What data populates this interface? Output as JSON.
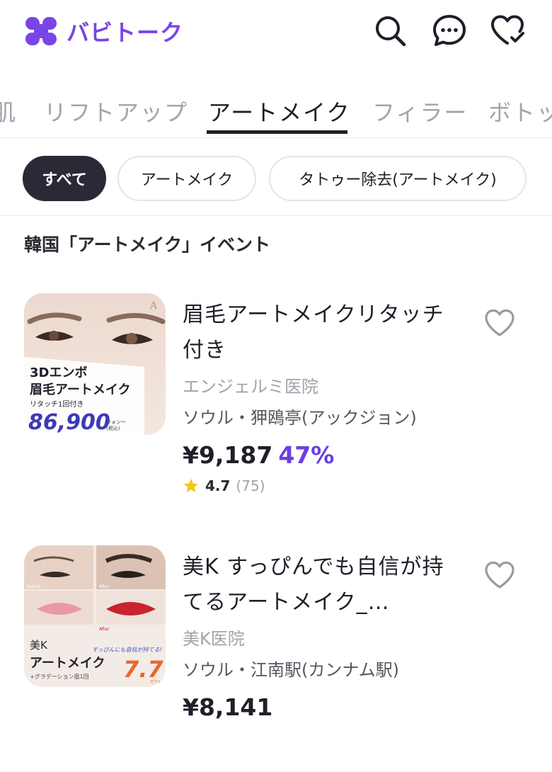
{
  "app": {
    "brand_name": "バビトーク",
    "brand_color": "#7a45e6"
  },
  "header": {
    "icons": [
      "search-icon",
      "chat-icon",
      "heart-check-icon"
    ]
  },
  "category_tabs": {
    "items": [
      {
        "label": "肌",
        "active": false
      },
      {
        "label": "リフトアップ",
        "active": false
      },
      {
        "label": "アートメイク",
        "active": true
      },
      {
        "label": "フィラー",
        "active": false
      },
      {
        "label": "ボトッ",
        "active": false
      }
    ]
  },
  "filter_chips": {
    "items": [
      {
        "label": "すべて",
        "active": true
      },
      {
        "label": "アートメイク",
        "active": false
      },
      {
        "label": "タトゥー除去(アートメイク)",
        "active": false
      }
    ]
  },
  "section": {
    "title": "韓国「アートメイク」イベント"
  },
  "events": [
    {
      "title": "眉毛アートメイクリタッチ付き",
      "clinic": "エンジェルミ医院",
      "location": "ソウル・狎鴎亭(アックジョン)",
      "price": "¥9,187",
      "discount": "47%",
      "rating": "4.7",
      "reviews": "(75)",
      "thumb": {
        "line1": "3Dエンボ",
        "line2": "眉毛アートメイク",
        "line3": "リタッチ1回付き",
        "price": "86,900",
        "unit": "ウォン〜",
        "tax": "(税込)"
      }
    },
    {
      "title": "美K すっぴんでも自信が持てるアートメイク_…",
      "clinic": "美K医院",
      "location": "ソウル・江南駅(カンナム駅)",
      "price": "¥8,141",
      "discount": "",
      "thumb": {
        "before": "Before",
        "after": "After",
        "brand": "美K",
        "title": "アートメイク",
        "sub": "+グラデーション眉1回",
        "tagline": "すっぴんにも自信が持てる!",
        "price": "7.7",
        "unit": "万ウォン"
      }
    }
  ]
}
